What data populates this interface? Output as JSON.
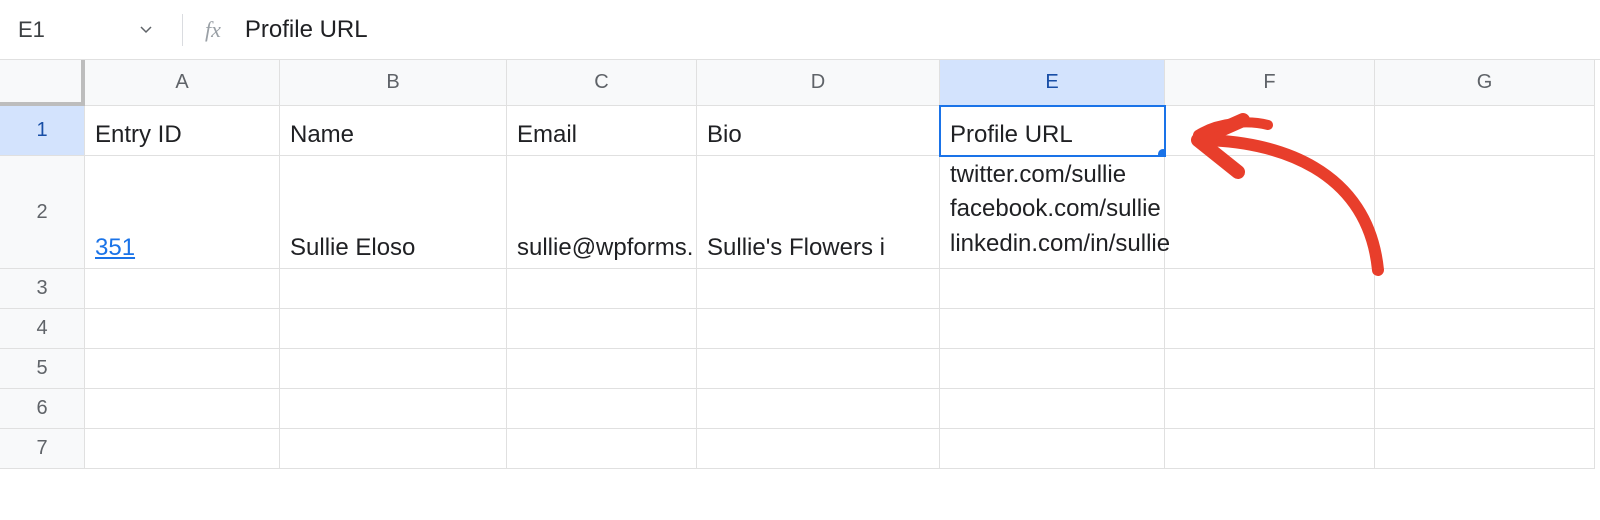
{
  "nameBox": "E1",
  "formulaValue": "Profile URL",
  "columns": [
    "A",
    "B",
    "C",
    "D",
    "E",
    "F",
    "G"
  ],
  "selectedColumn": "E",
  "selectedRow": "1",
  "rowLabels": [
    "1",
    "2",
    "3",
    "4",
    "5",
    "6",
    "7"
  ],
  "cells": {
    "A1": "Entry ID",
    "B1": "Name",
    "C1": "Email",
    "D1": "Bio",
    "E1": "Profile URL",
    "A2": "351",
    "B2": "Sullie Eloso",
    "C2": "sullie@wpforms.",
    "D2": "Sullie's Flowers i",
    "E2": "twitter.com/sullie\nfacebook.com/sullie\nlinkedin.com/in/sullie"
  },
  "accent": "#1a73e8",
  "annotationColor": "#e83e2b"
}
